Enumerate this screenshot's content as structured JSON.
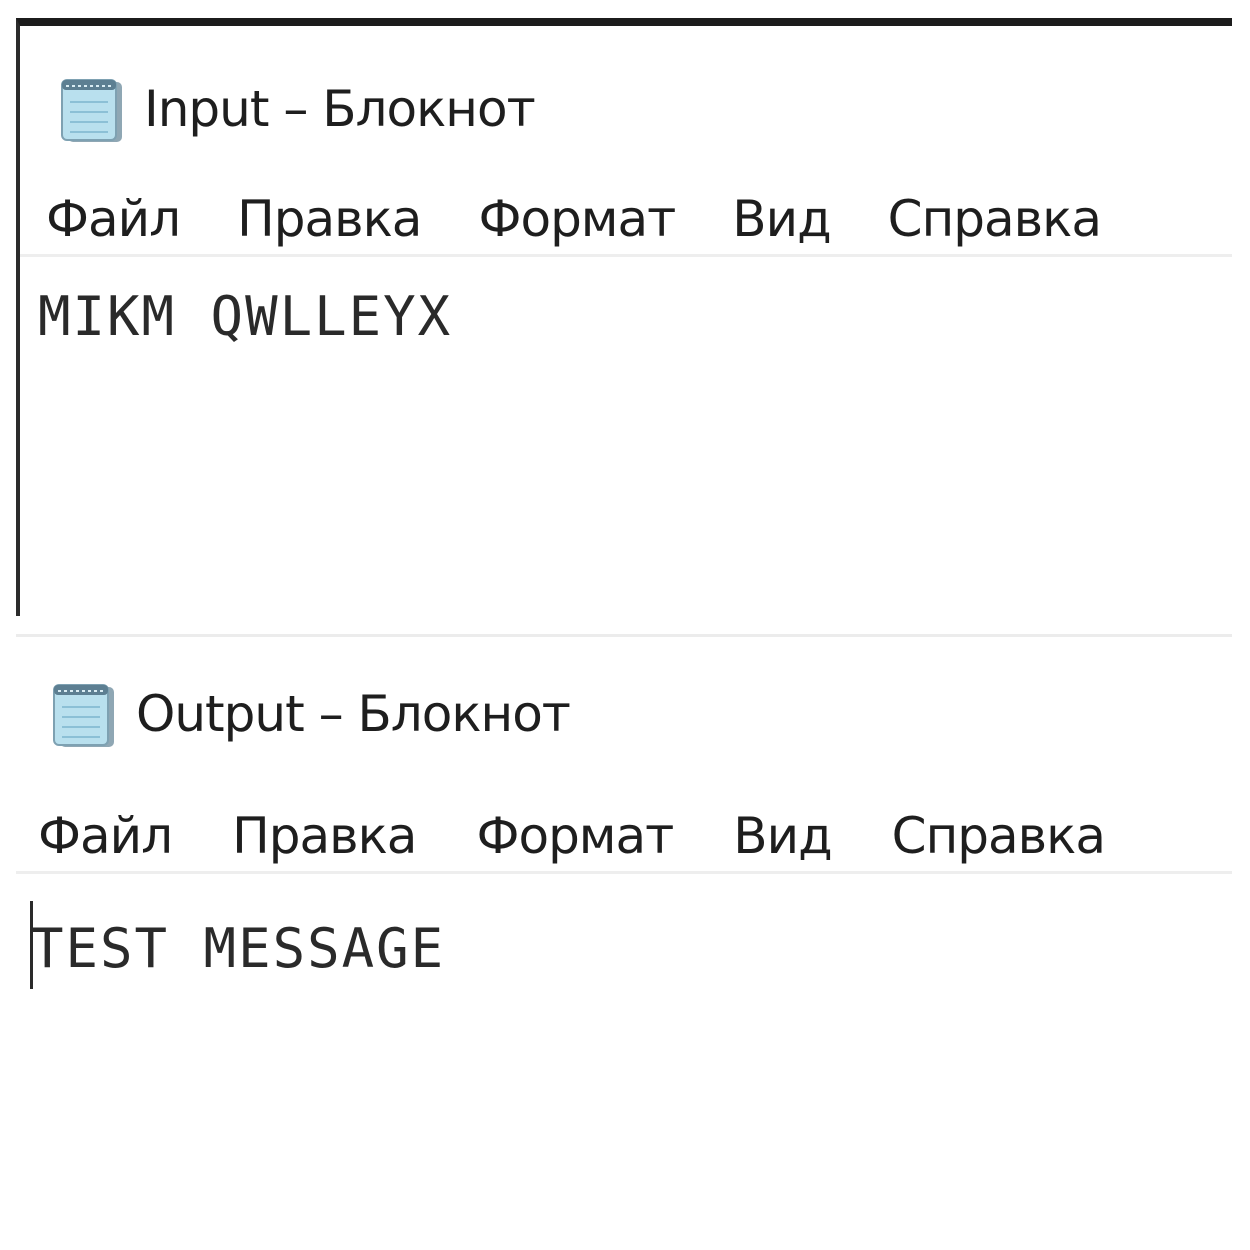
{
  "windows": [
    {
      "title": "Input – Блокнот",
      "menu": [
        "Файл",
        "Правка",
        "Формат",
        "Вид",
        "Справка"
      ],
      "content": "MIKM QWLLEYX"
    },
    {
      "title": "Output – Блокнот",
      "menu": [
        "Файл",
        "Правка",
        "Формат",
        "Вид",
        "Справка"
      ],
      "content": "TEST MESSAGE"
    }
  ],
  "icons": {
    "app_icon": "notepad-icon"
  },
  "colors": {
    "text": "#1e1e1e",
    "icon_blue": "#a9d4e6",
    "window_border": "#1c1c1c",
    "separator": "#eeeeee"
  }
}
